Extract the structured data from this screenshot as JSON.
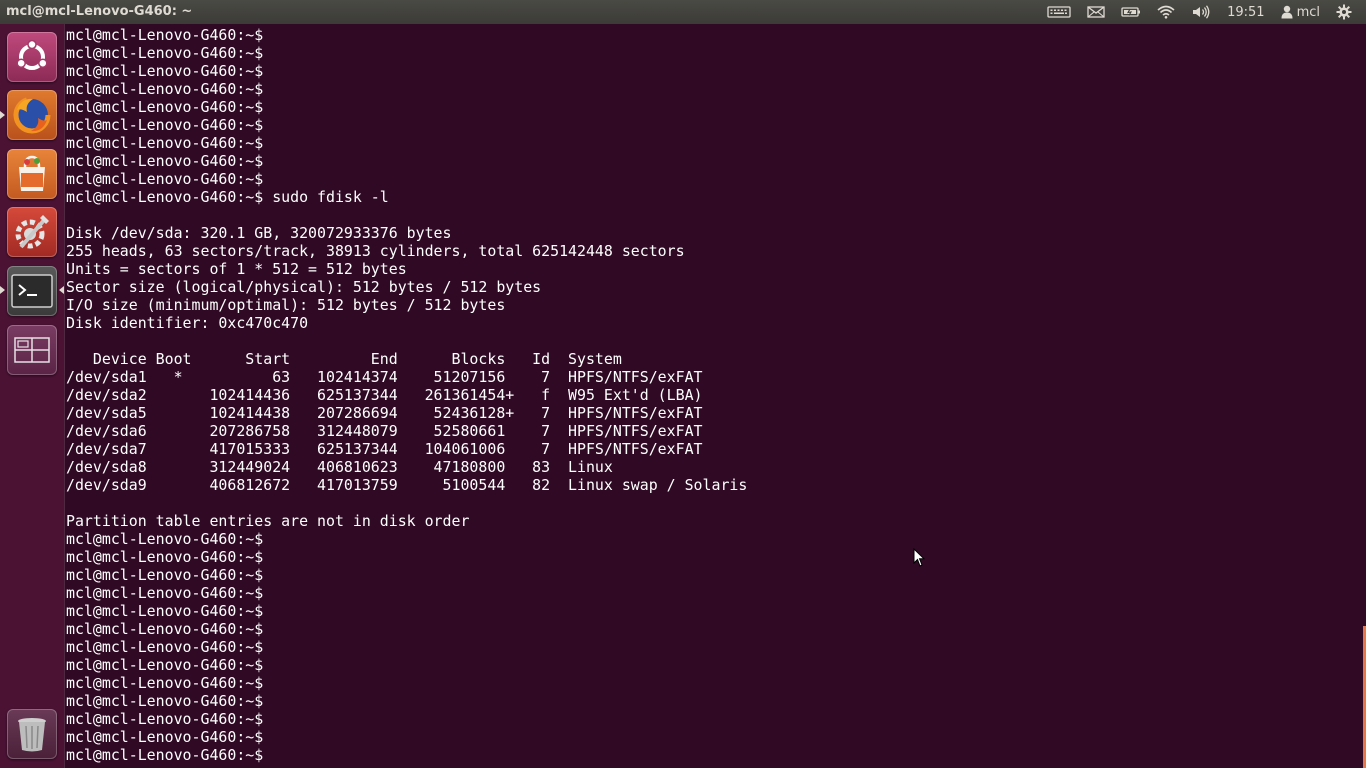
{
  "top_panel": {
    "window_title": "mcl@mcl-Lenovo-G460: ~",
    "clock": "19:51",
    "user": "mcl",
    "indicator_icons": [
      "keyboard-icon",
      "mail-icon",
      "battery-icon",
      "wifi-icon",
      "volume-icon",
      "user-icon",
      "gear-icon"
    ]
  },
  "launcher": {
    "items": [
      {
        "name": "dash-home",
        "icon": "ubuntu-logo-icon"
      },
      {
        "name": "firefox",
        "icon": "firefox-icon"
      },
      {
        "name": "software-center",
        "icon": "shopping-bag-icon"
      },
      {
        "name": "system-settings",
        "icon": "settings-icon"
      },
      {
        "name": "terminal",
        "icon": "terminal-icon"
      },
      {
        "name": "workspace-switcher",
        "icon": "workspace-icon"
      },
      {
        "name": "trash",
        "icon": "trash-icon"
      }
    ]
  },
  "terminal": {
    "lines": [
      "mcl@mcl-Lenovo-G460:~$",
      "mcl@mcl-Lenovo-G460:~$",
      "mcl@mcl-Lenovo-G460:~$",
      "mcl@mcl-Lenovo-G460:~$",
      "mcl@mcl-Lenovo-G460:~$",
      "mcl@mcl-Lenovo-G460:~$",
      "mcl@mcl-Lenovo-G460:~$",
      "mcl@mcl-Lenovo-G460:~$",
      "mcl@mcl-Lenovo-G460:~$",
      "mcl@mcl-Lenovo-G460:~$ sudo fdisk -l",
      "",
      "Disk /dev/sda: 320.1 GB, 320072933376 bytes",
      "255 heads, 63 sectors/track, 38913 cylinders, total 625142448 sectors",
      "Units = sectors of 1 * 512 = 512 bytes",
      "Sector size (logical/physical): 512 bytes / 512 bytes",
      "I/O size (minimum/optimal): 512 bytes / 512 bytes",
      "Disk identifier: 0xc470c470",
      "",
      "   Device Boot      Start         End      Blocks   Id  System",
      "/dev/sda1   *          63   102414374    51207156    7  HPFS/NTFS/exFAT",
      "/dev/sda2       102414436   625137344   261361454+   f  W95 Ext'd (LBA)",
      "/dev/sda5       102414438   207286694    52436128+   7  HPFS/NTFS/exFAT",
      "/dev/sda6       207286758   312448079    52580661    7  HPFS/NTFS/exFAT",
      "/dev/sda7       417015333   625137344   104061006    7  HPFS/NTFS/exFAT",
      "/dev/sda8       312449024   406810623    47180800   83  Linux",
      "/dev/sda9       406812672   417013759     5100544   82  Linux swap / Solaris",
      "",
      "Partition table entries are not in disk order",
      "mcl@mcl-Lenovo-G460:~$",
      "mcl@mcl-Lenovo-G460:~$",
      "mcl@mcl-Lenovo-G460:~$",
      "mcl@mcl-Lenovo-G460:~$",
      "mcl@mcl-Lenovo-G460:~$",
      "mcl@mcl-Lenovo-G460:~$",
      "mcl@mcl-Lenovo-G460:~$",
      "mcl@mcl-Lenovo-G460:~$",
      "mcl@mcl-Lenovo-G460:~$",
      "mcl@mcl-Lenovo-G460:~$",
      "mcl@mcl-Lenovo-G460:~$",
      "mcl@mcl-Lenovo-G460:~$",
      "mcl@mcl-Lenovo-G460:~$"
    ],
    "colors": {
      "background": "#300a24",
      "text": "#ffffff",
      "accent": "#e6774a"
    }
  }
}
